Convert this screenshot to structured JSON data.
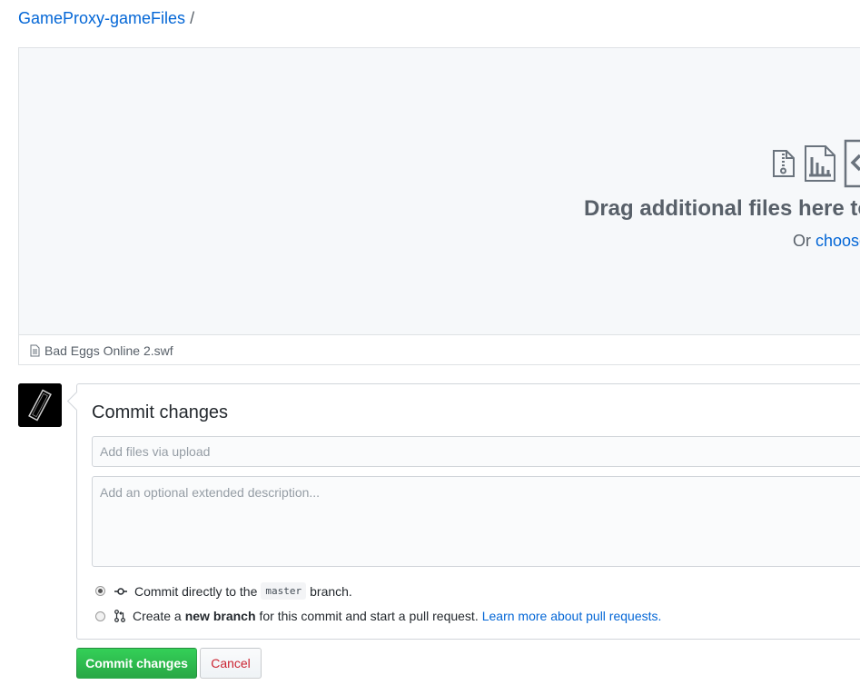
{
  "breadcrumb": {
    "repo": "GameProxy-gameFiles",
    "separator": "/"
  },
  "dropzone": {
    "title": "Drag additional files here to",
    "sub_prefix": "Or ",
    "choose_link": "choose",
    "icons": [
      "zip-file-icon",
      "chart-file-icon",
      "code-file-icon"
    ]
  },
  "files": [
    {
      "name": "Bad Eggs Online 2.swf",
      "icon": "file-icon"
    }
  ],
  "commit": {
    "title": "Commit changes",
    "summary_placeholder": "Add files via upload",
    "description_placeholder": "Add an optional extended description...",
    "option_direct": {
      "prefix": "Commit directly to the",
      "branch": "master",
      "suffix": "branch.",
      "checked": true
    },
    "option_new": {
      "prefix": "Create a",
      "bold": "new branch",
      "suffix": "for this commit and start a pull request.",
      "link": "Learn more about pull requests.",
      "checked": false
    }
  },
  "buttons": {
    "commit": "Commit changes",
    "cancel": "Cancel"
  },
  "colors": {
    "link": "#0366d6",
    "primary": "#28a745",
    "danger": "#cb2431"
  }
}
